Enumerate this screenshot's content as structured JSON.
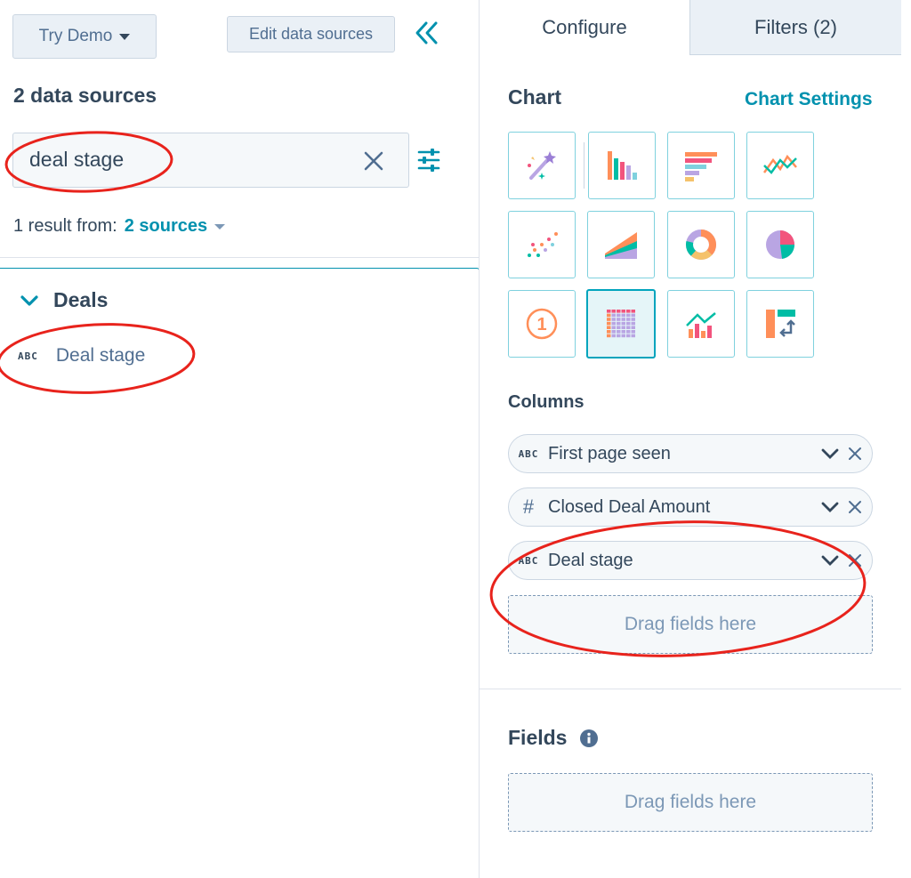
{
  "left_panel": {
    "try_demo_label": "Try Demo",
    "edit_sources_label": "Edit data sources",
    "sources_title": "2 data sources",
    "search": {
      "value": "deal stage"
    },
    "result": {
      "prefix": "1 result from:",
      "link": "2 sources"
    },
    "groups": [
      {
        "label": "Deals",
        "fields": [
          {
            "type": "ABC",
            "label": "Deal stage"
          }
        ]
      }
    ]
  },
  "right_panel": {
    "tabs": [
      {
        "label": "Configure"
      },
      {
        "label": "Filters (2)"
      }
    ],
    "chart_title": "Chart",
    "chart_settings": "Chart Settings",
    "chart_types": [
      {
        "icon": "magic-wand-icon"
      },
      {
        "icon": "vertical-bar-chart-icon"
      },
      {
        "icon": "horizontal-bar-chart-icon"
      },
      {
        "icon": "line-chart-icon"
      },
      {
        "icon": "scatter-chart-icon"
      },
      {
        "icon": "area-chart-icon"
      },
      {
        "icon": "donut-chart-icon"
      },
      {
        "icon": "pie-chart-icon"
      },
      {
        "icon": "summary-number-icon",
        "text": "1"
      },
      {
        "icon": "table-chart-icon",
        "selected": true
      },
      {
        "icon": "combo-chart-icon"
      },
      {
        "icon": "pivot-table-icon"
      }
    ],
    "columns_title": "Columns",
    "columns": [
      {
        "type": "ABC",
        "label": "First page seen"
      },
      {
        "type": "#",
        "label": "Closed Deal Amount"
      },
      {
        "type": "ABC",
        "label": "Deal stage"
      }
    ],
    "drop_label": "Drag fields here",
    "fields_title": "Fields",
    "fields_drop_label": "Drag fields here"
  },
  "colors": {
    "accent": "#0091ae",
    "annotation": "#e8231c",
    "text": "#33475b"
  }
}
